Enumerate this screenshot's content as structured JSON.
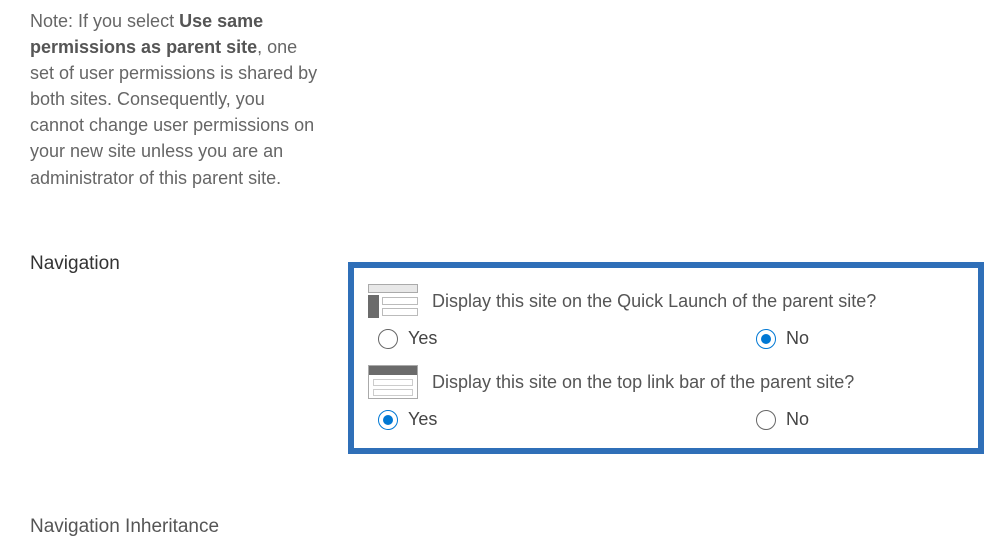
{
  "note": {
    "prefix": "Note: If you select ",
    "bold": "Use same permissions as parent site",
    "suffix": ", one set of user permissions is shared by both sites. Consequently, you cannot change user permissions on your new site unless you are an administrator of this parent site."
  },
  "sections": {
    "navigation": "Navigation",
    "navigation_inheritance": "Navigation Inheritance"
  },
  "nav_panel": {
    "quick_launch": {
      "question": "Display this site on the Quick Launch of the parent site?",
      "yes": "Yes",
      "no": "No",
      "selected": "no"
    },
    "top_link": {
      "question": "Display this site on the top link bar of the parent site?",
      "yes": "Yes",
      "no": "No",
      "selected": "yes"
    }
  }
}
